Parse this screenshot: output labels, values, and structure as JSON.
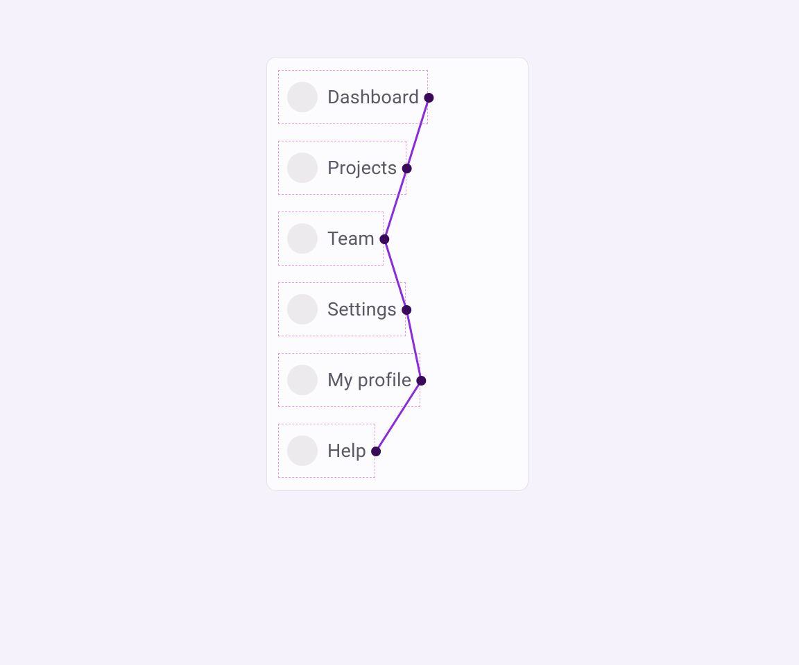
{
  "nav": {
    "items": [
      {
        "label": "Dashboard"
      },
      {
        "label": "Projects"
      },
      {
        "label": "Team"
      },
      {
        "label": "Settings"
      },
      {
        "label": "My profile"
      },
      {
        "label": "Help"
      }
    ]
  },
  "overlay": {
    "line_color": "#8a2be2",
    "dot_color": "#3a0a5a"
  }
}
